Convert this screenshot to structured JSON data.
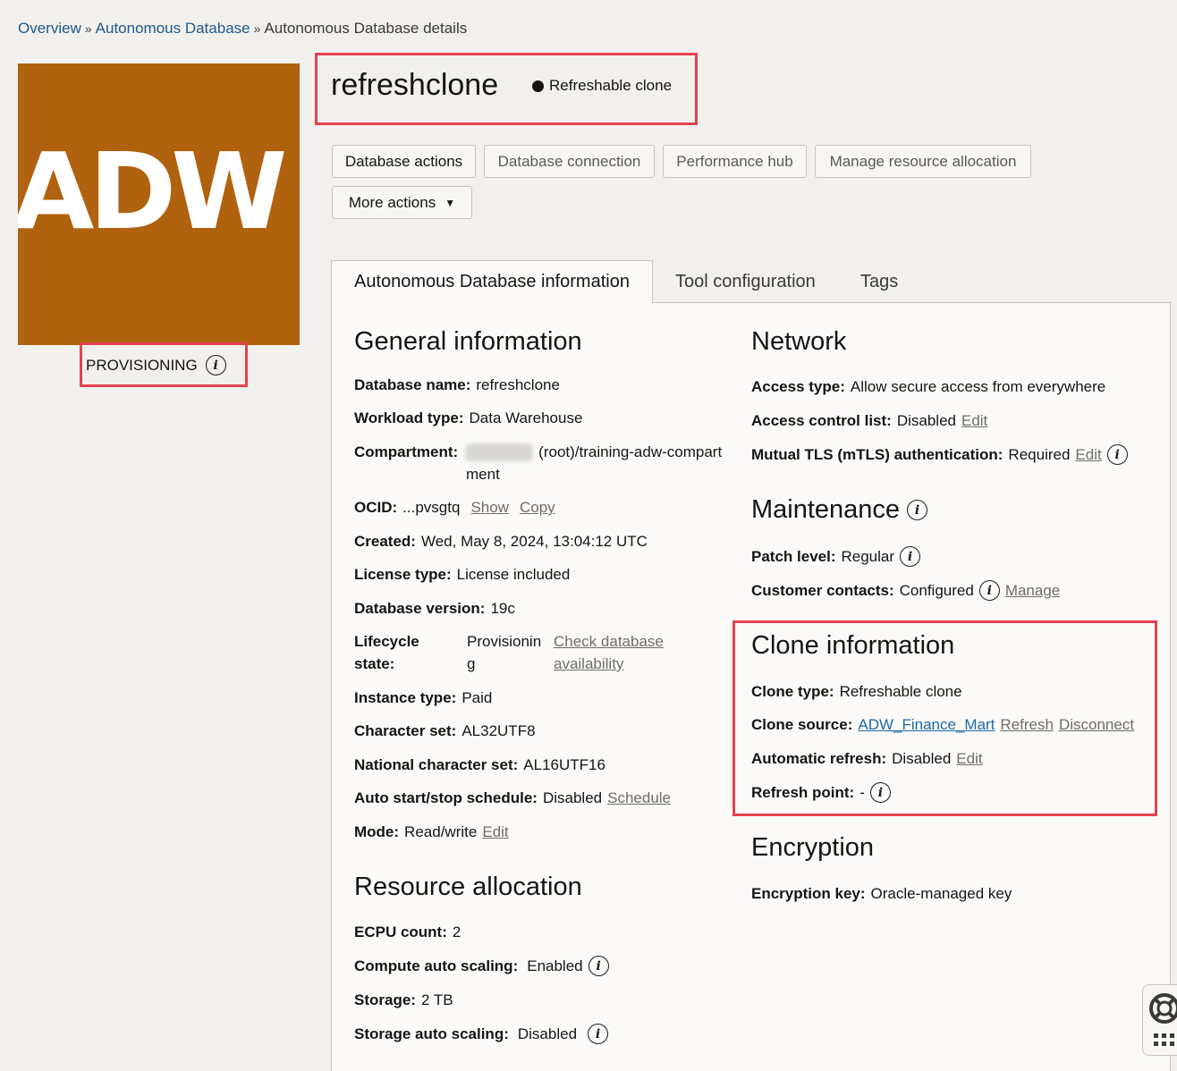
{
  "breadcrumb": {
    "items": [
      "Overview",
      "Autonomous Database"
    ],
    "current": "Autonomous Database details",
    "separator": "»"
  },
  "logo": {
    "text": "ADW",
    "bg_color": "#b0620e"
  },
  "status": {
    "label": "PROVISIONING"
  },
  "header": {
    "title": "refreshclone",
    "badge": "Refreshable clone"
  },
  "actions": {
    "database_actions": "Database actions",
    "database_connection": "Database connection",
    "performance_hub": "Performance hub",
    "manage_resource_allocation": "Manage resource allocation",
    "more_actions": "More actions"
  },
  "tabs": [
    "Autonomous Database information",
    "Tool configuration",
    "Tags"
  ],
  "general": {
    "title": "General information",
    "database_name_label": "Database name:",
    "database_name": "refreshclone",
    "workload_type_label": "Workload type:",
    "workload_type": "Data Warehouse",
    "compartment_label": "Compartment:",
    "compartment_line1": "(root)/training-adw-compart",
    "compartment_line2": "ment",
    "ocid_label": "OCID:",
    "ocid": "...pvsgtq",
    "show": "Show",
    "copy": "Copy",
    "created_label": "Created:",
    "created": "Wed, May 8, 2024, 13:04:12 UTC",
    "license_type_label": "License type:",
    "license_type": "License included",
    "database_version_label": "Database version:",
    "database_version": "19c",
    "lifecycle_label1": "Lifecycle",
    "lifecycle_label2": "state:",
    "lifecycle_value1": "Provisionin",
    "lifecycle_value2": "g",
    "check_availability1": "Check database",
    "check_availability2": "availability",
    "instance_type_label": "Instance type:",
    "instance_type": "Paid",
    "character_set_label": "Character set:",
    "character_set": "AL32UTF8",
    "national_character_set_label": "National character set:",
    "national_character_set": "AL16UTF16",
    "auto_schedule_label": "Auto start/stop schedule:",
    "auto_schedule": "Disabled",
    "schedule_link": "Schedule",
    "mode_label": "Mode:",
    "mode": "Read/write",
    "edit": "Edit"
  },
  "resource": {
    "title": "Resource allocation",
    "ecpu_label": "ECPU count:",
    "ecpu": "2",
    "compute_scaling_label": "Compute auto scaling:",
    "compute_scaling": "Enabled",
    "storage_label": "Storage:",
    "storage": "2 TB",
    "storage_scaling_label": "Storage auto scaling:",
    "storage_scaling": "Disabled"
  },
  "network": {
    "title": "Network",
    "access_type_label": "Access type:",
    "access_type": "Allow secure access from everywhere",
    "acl_label": "Access control list:",
    "acl": "Disabled",
    "mtls_label": "Mutual TLS (mTLS) authentication:",
    "mtls": "Required",
    "edit": "Edit"
  },
  "maintenance": {
    "title": "Maintenance",
    "patch_level_label": "Patch level:",
    "patch_level": "Regular",
    "customer_contacts_label": "Customer contacts:",
    "customer_contacts": "Configured",
    "manage": "Manage"
  },
  "clone": {
    "title": "Clone information",
    "clone_type_label": "Clone type:",
    "clone_type": "Refreshable clone",
    "clone_source_label": "Clone source:",
    "clone_source": "ADW_Finance_Mart",
    "refresh": "Refresh",
    "disconnect": "Disconnect",
    "auto_refresh_label": "Automatic refresh:",
    "auto_refresh": "Disabled",
    "edit": "Edit",
    "refresh_point_label": "Refresh point:",
    "refresh_point": "-"
  },
  "encryption": {
    "title": "Encryption",
    "key_label": "Encryption key:",
    "key": "Oracle-managed key"
  }
}
